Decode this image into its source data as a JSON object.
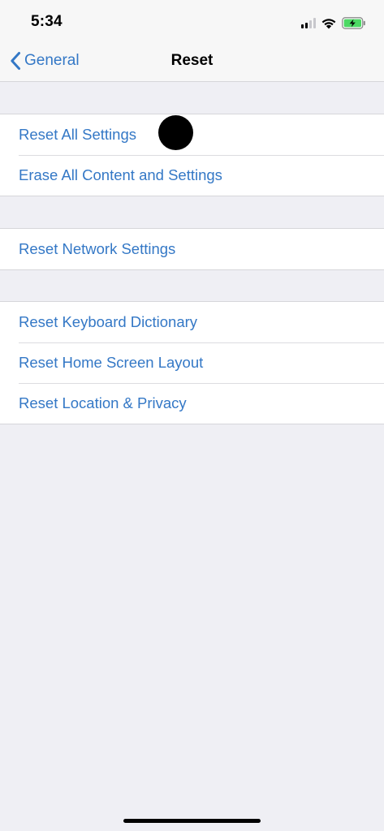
{
  "status_bar": {
    "time": "5:34",
    "icons": [
      "cellular-signal-icon",
      "wifi-icon",
      "battery-charging-icon"
    ],
    "battery_color": "#4cd964"
  },
  "nav": {
    "back_label": "General",
    "title": "Reset"
  },
  "groups": [
    {
      "items": [
        {
          "label": "Reset All Settings"
        },
        {
          "label": "Erase All Content and Settings"
        }
      ]
    },
    {
      "items": [
        {
          "label": "Reset Network Settings"
        }
      ]
    },
    {
      "items": [
        {
          "label": "Reset Keyboard Dictionary"
        },
        {
          "label": "Reset Home Screen Layout"
        },
        {
          "label": "Reset Location & Privacy"
        }
      ]
    }
  ],
  "colors": {
    "accent": "#3478c6",
    "background": "#efeff4",
    "cell": "#ffffff"
  }
}
